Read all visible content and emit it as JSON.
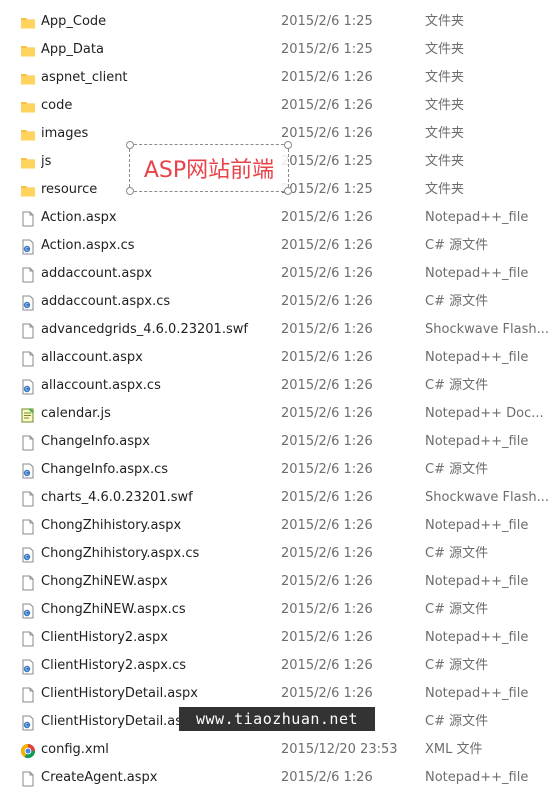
{
  "files": [
    {
      "name": "App_Code",
      "date": "2015/2/6 1:25",
      "type": "文件夹",
      "icon": "folder-icon"
    },
    {
      "name": "App_Data",
      "date": "2015/2/6 1:25",
      "type": "文件夹",
      "icon": "folder-icon"
    },
    {
      "name": "aspnet_client",
      "date": "2015/2/6 1:26",
      "type": "文件夹",
      "icon": "folder-icon"
    },
    {
      "name": "code",
      "date": "2015/2/6 1:26",
      "type": "文件夹",
      "icon": "folder-icon"
    },
    {
      "name": "images",
      "date": "2015/2/6 1:26",
      "type": "文件夹",
      "icon": "folder-icon"
    },
    {
      "name": "js",
      "date": "2015/2/6 1:25",
      "type": "文件夹",
      "icon": "folder-icon"
    },
    {
      "name": "resource",
      "date": "2015/2/6 1:25",
      "type": "文件夹",
      "icon": "folder-icon"
    },
    {
      "name": "Action.aspx",
      "date": "2015/2/6 1:26",
      "type": "Notepad++_file",
      "icon": "file-icon"
    },
    {
      "name": "Action.aspx.cs",
      "date": "2015/2/6 1:26",
      "type": "C# 源文件",
      "icon": "csharp-file-icon"
    },
    {
      "name": "addaccount.aspx",
      "date": "2015/2/6 1:26",
      "type": "Notepad++_file",
      "icon": "file-icon"
    },
    {
      "name": "addaccount.aspx.cs",
      "date": "2015/2/6 1:26",
      "type": "C# 源文件",
      "icon": "csharp-file-icon"
    },
    {
      "name": "advancedgrids_4.6.0.23201.swf",
      "date": "2015/2/6 1:26",
      "type": "Shockwave Flash...",
      "icon": "file-icon"
    },
    {
      "name": "allaccount.aspx",
      "date": "2015/2/6 1:26",
      "type": "Notepad++_file",
      "icon": "file-icon"
    },
    {
      "name": "allaccount.aspx.cs",
      "date": "2015/2/6 1:26",
      "type": "C# 源文件",
      "icon": "csharp-file-icon"
    },
    {
      "name": "calendar.js",
      "date": "2015/2/6 1:26",
      "type": "Notepad++ Doc...",
      "icon": "notepad-doc-icon"
    },
    {
      "name": "ChangeInfo.aspx",
      "date": "2015/2/6 1:26",
      "type": "Notepad++_file",
      "icon": "file-icon"
    },
    {
      "name": "ChangeInfo.aspx.cs",
      "date": "2015/2/6 1:26",
      "type": "C# 源文件",
      "icon": "csharp-file-icon"
    },
    {
      "name": "charts_4.6.0.23201.swf",
      "date": "2015/2/6 1:26",
      "type": "Shockwave Flash...",
      "icon": "file-icon"
    },
    {
      "name": "ChongZhihistory.aspx",
      "date": "2015/2/6 1:26",
      "type": "Notepad++_file",
      "icon": "file-icon"
    },
    {
      "name": "ChongZhihistory.aspx.cs",
      "date": "2015/2/6 1:26",
      "type": "C# 源文件",
      "icon": "csharp-file-icon"
    },
    {
      "name": "ChongZhiNEW.aspx",
      "date": "2015/2/6 1:26",
      "type": "Notepad++_file",
      "icon": "file-icon"
    },
    {
      "name": "ChongZhiNEW.aspx.cs",
      "date": "2015/2/6 1:26",
      "type": "C# 源文件",
      "icon": "csharp-file-icon"
    },
    {
      "name": "ClientHistory2.aspx",
      "date": "2015/2/6 1:26",
      "type": "Notepad++_file",
      "icon": "file-icon"
    },
    {
      "name": "ClientHistory2.aspx.cs",
      "date": "2015/2/6 1:26",
      "type": "C# 源文件",
      "icon": "csharp-file-icon"
    },
    {
      "name": "ClientHistoryDetail.aspx",
      "date": "2015/2/6 1:26",
      "type": "Notepad++_file",
      "icon": "file-icon"
    },
    {
      "name": "ClientHistoryDetail.aspx",
      "date": "2015/2/6 1:26",
      "type": "C# 源文件",
      "icon": "csharp-file-icon"
    },
    {
      "name": "config.xml",
      "date": "2015/12/20 23:53",
      "type": "XML 文件",
      "icon": "chrome-icon"
    },
    {
      "name": "CreateAgent.aspx",
      "date": "2015/2/6 1:26",
      "type": "Notepad++_file",
      "icon": "file-icon"
    }
  ],
  "watermark": {
    "text": "ASP网站前端",
    "color": "#e8434a"
  },
  "url_banner": {
    "text": "www.tiaozhuan.net"
  },
  "colors": {
    "folder": "#f5c242",
    "csharp_badge": "#3a78c8",
    "muted_text": "#6d6d6d"
  }
}
